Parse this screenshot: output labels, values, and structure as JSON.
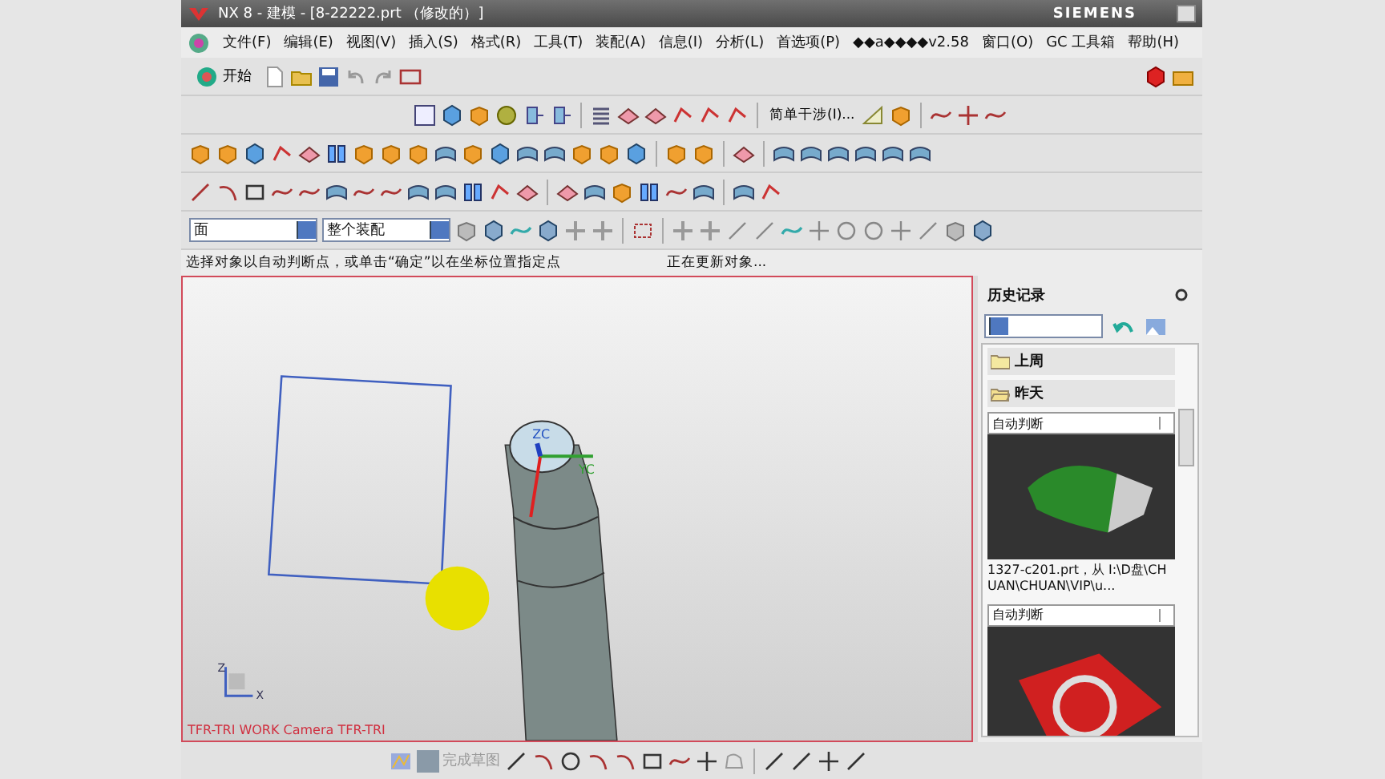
{
  "window": {
    "title": "NX 8 - 建模 - [8-22222.prt （修改的）]",
    "brand": "SIEMENS"
  },
  "menu": [
    {
      "label": "文件(F)"
    },
    {
      "label": "编辑(E)"
    },
    {
      "label": "视图(V)"
    },
    {
      "label": "插入(S)"
    },
    {
      "label": "格式(R)"
    },
    {
      "label": "工具(T)"
    },
    {
      "label": "装配(A)"
    },
    {
      "label": "信息(I)"
    },
    {
      "label": "分析(L)"
    },
    {
      "label": "首选项(P)"
    },
    {
      "label": "◆◆a◆◆◆◆v2.58"
    },
    {
      "label": "窗口(O)"
    },
    {
      "label": "GC 工具箱"
    },
    {
      "label": "帮助(H)"
    }
  ],
  "start_button": "开始",
  "interference_button": "简单干涉(I)...",
  "selection": {
    "filter": "面",
    "scope": "整个装配"
  },
  "cue_line": {
    "prompt": "选择对象以自动判断点，或单击“确定”以在坐标位置指定点",
    "status": "正在更新对象..."
  },
  "viewport": {
    "view_label": "TFR-TRI WORK Camera TFR-TRI",
    "wcs_axes": [
      "ZC",
      "YC"
    ],
    "triad_axes": [
      "Z",
      "X"
    ]
  },
  "history": {
    "title": "历史记录",
    "groups": [
      {
        "label": "上周",
        "expanded": false
      },
      {
        "label": "昨天",
        "expanded": true
      }
    ],
    "items": [
      {
        "mode": "自动判断",
        "kind": "green",
        "caption": "1327-c201.prt，从 I:\\D盘\\CHUAN\\CHUAN\\VIP\\u..."
      },
      {
        "mode": "自动判断",
        "kind": "red"
      }
    ]
  },
  "sketch_toolbar": {
    "finish_label": "完成草图"
  }
}
